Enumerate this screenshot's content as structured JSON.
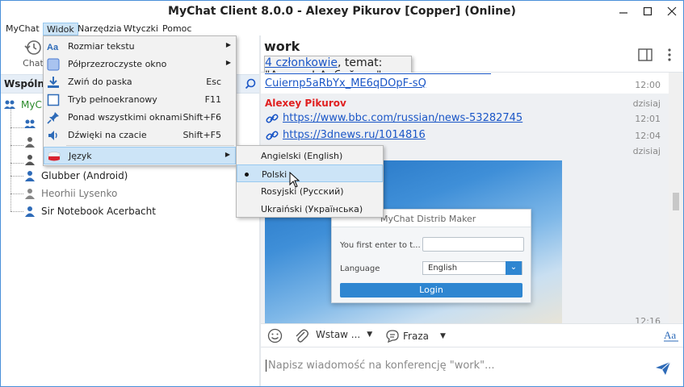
{
  "window": {
    "title": "MyChat Client 8.0.0 - Alexey Pikurov [Copper] (Online)"
  },
  "menubar": [
    "MyChat",
    "Widok",
    "Narzędzia",
    "Wtyczki",
    "Pomoc"
  ],
  "left": {
    "toolbar": {
      "chat_label": "Chat"
    },
    "pane_title": "Wspólne",
    "tree_root": "MyC",
    "contacts": [
      {
        "name": "Glubber (Android)",
        "status": "online"
      },
      {
        "name": "Heorhii Lysenko",
        "status": "offline"
      },
      {
        "name": "Sir Notebook Acerbacht",
        "status": "online"
      }
    ]
  },
  "view_menu": {
    "items": [
      {
        "label": "Rozmiar tekstu",
        "shortcut": "",
        "submenu": true,
        "icon": "text-size-icon"
      },
      {
        "label": "Półprzezroczyste okno",
        "shortcut": "",
        "submenu": true,
        "icon": "transparent-window-icon"
      },
      {
        "label": "Zwiń do paska",
        "shortcut": "Esc",
        "submenu": false,
        "icon": "minimize-tray-icon"
      },
      {
        "label": "Tryb pełnoekranowy",
        "shortcut": "F11",
        "submenu": false,
        "icon": "fullscreen-icon"
      },
      {
        "label": "Ponad wszystkimi oknami",
        "shortcut": "Shift+F6",
        "submenu": false,
        "icon": "pin-icon"
      },
      {
        "label": "Dźwięki na czacie",
        "shortcut": "Shift+F5",
        "submenu": false,
        "icon": "speaker-icon"
      },
      {
        "label": "Język",
        "shortcut": "",
        "submenu": true,
        "icon": "flag-icon"
      }
    ]
  },
  "language_menu": {
    "items": [
      {
        "label": "Angielski (English)",
        "selected": false
      },
      {
        "label": "Polski",
        "selected": true
      },
      {
        "label": "Rosyjski (Русский)",
        "selected": false
      },
      {
        "label": "Ukraiński (Українська)",
        "selected": false
      }
    ]
  },
  "chat": {
    "room": "work",
    "members_link": "4 członkowie",
    "topic": ", temat: \"Ахтунг! Арбайтен\"",
    "messages": {
      "prev_link": "Cuiernp5aRbYx_ME6qDOpF-sQ",
      "prev_time": "12:00",
      "author": "Alexey Pikurov",
      "day1": "dzisiaj",
      "link1": "https://www.bbc.com/russian/news-53282745",
      "time1": "12:01",
      "link2": "https://3dnews.ru/1014816",
      "time2": "12:04",
      "day2": "dzisiaj",
      "time3": "12:16"
    },
    "image_dialog": {
      "title": "MyChat Distrib Maker",
      "first_label": "You first enter to t...",
      "language_label": "Language",
      "language_value": "English",
      "login_button": "Login"
    },
    "toolbar": {
      "insert_label": "Wstaw ...",
      "phrase_label": "Fraza"
    },
    "input_placeholder": "Napisz wiadomość na konferencję \"work\"..."
  },
  "colors": {
    "accent": "#2e86d1",
    "link": "#1a56c7",
    "author": "#e02020",
    "highlight": "#cce4f7"
  }
}
